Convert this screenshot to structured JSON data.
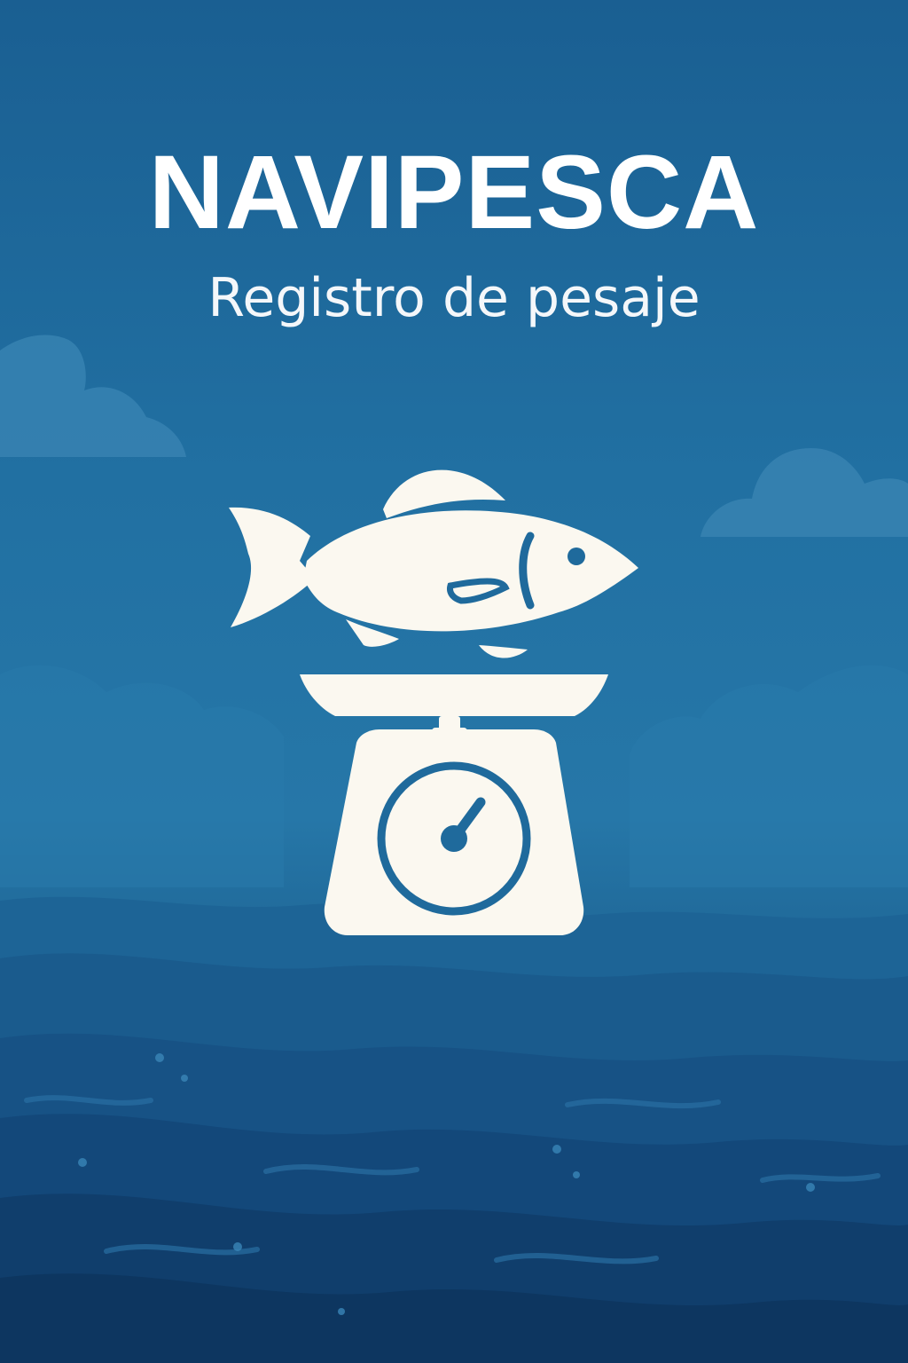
{
  "app": {
    "title": "NAVIPESCA",
    "subtitle": "Registro de pesaje"
  },
  "logo": {
    "icons": [
      "fish-icon",
      "weighing-scale-icon"
    ],
    "color": "#fbf8f0"
  },
  "colors": {
    "sky_top": "#1a5f92",
    "sky_mid": "#2677a8",
    "sea_dark": "#0f3a66",
    "cloud": "#3a86b4",
    "foreground": "#fbf8f0"
  }
}
